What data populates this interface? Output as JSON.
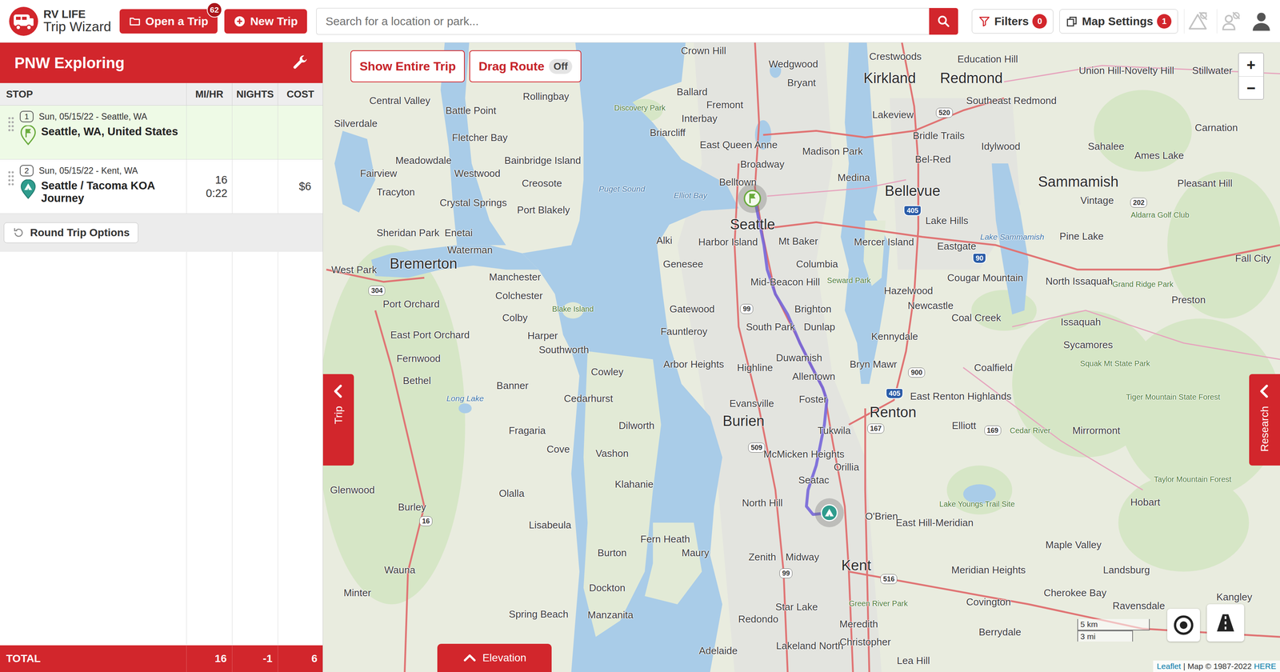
{
  "brand": {
    "line1": "RV LIFE",
    "line2": "Trip Wizard"
  },
  "toolbar": {
    "open_trip": {
      "label": "Open a Trip",
      "badge": "62"
    },
    "new_trip": {
      "label": "New Trip"
    },
    "search": {
      "placeholder": "Search for a location or park..."
    },
    "filters": {
      "label": "Filters",
      "badge": "0"
    },
    "map_settings": {
      "label": "Map Settings",
      "badge": "1"
    },
    "toggles": [
      {
        "kind": "hazard",
        "on": false
      },
      {
        "kind": "person",
        "on": false
      }
    ]
  },
  "trip": {
    "title": "PNW Exploring",
    "columns": [
      "STOP",
      "MI/HR",
      "NIGHTS",
      "COST"
    ],
    "stops": [
      {
        "number": "1",
        "date": "Sun, 05/15/22 - Seattle, WA",
        "name": "Seattle, WA, United States",
        "kind": "start",
        "miles": "",
        "time": "",
        "nights": "",
        "cost": "",
        "selected": true
      },
      {
        "number": "2",
        "date": "Sun, 05/15/22 - Kent, WA",
        "name": "Seattle / Tacoma KOA Journey",
        "kind": "campground",
        "miles": "16",
        "time": "0:22",
        "nights": "",
        "cost": "$6",
        "selected": false
      }
    ],
    "round_trip": "Round Trip Options",
    "total": {
      "label": "TOTAL",
      "miles": "16",
      "nights": "-1",
      "cost": "6"
    }
  },
  "map": {
    "show_entire_trip": "Show Entire Trip",
    "drag_route": {
      "label": "Drag Route",
      "state": "Off",
      "on": false
    },
    "zoom": [
      "+",
      "−"
    ],
    "side_tabs": {
      "trip": "Trip",
      "research": "Research"
    },
    "elevation": "Elevation",
    "scale": {
      "metric": "5 km",
      "imperial": "3 mi"
    },
    "attribution": {
      "leaflet": "Leaflet",
      "copyright": "| Map © 1987-2022",
      "provider": "HERE"
    },
    "cities": [
      "Seattle",
      "Bellevue",
      "Kirkland",
      "Redmond",
      "Renton",
      "Kent",
      "Burien",
      "Bremerton",
      "Sammamish"
    ],
    "places": [
      "Crown Hill",
      "Wedgwood",
      "Bryant",
      "Ballard",
      "Fremont",
      "Interbay",
      "Briarcliff",
      "East Queen Anne",
      "Madison Park",
      "Belltown",
      "Broadway",
      "Medina",
      "Alki",
      "Harbor Island",
      "Mt Baker",
      "Genesee",
      "Columbia",
      "Mid-Beacon Hill",
      "Gatewood",
      "Brighton",
      "Fauntleroy",
      "South Park",
      "Dunlap",
      "Arbor Heights",
      "Highline",
      "Duwamish",
      "Allentown",
      "Bryn Mawr",
      "Evansville",
      "Foster",
      "Tukwila",
      "McMicken Heights",
      "Orillia",
      "Seatac",
      "North Hill",
      "O'Brien",
      "Zenith",
      "Midway",
      "Star Lake",
      "Redondo",
      "Lakeland North",
      "Meredith",
      "Kennydale",
      "Mercer Island",
      "Newcastle",
      "Coal Creek",
      "Coalfield",
      "East Renton Highlands",
      "Elliott",
      "East Hill-Meridian",
      "Lakeview",
      "Bridle Trails",
      "Bel-Red",
      "Lake Hills",
      "Eastgate",
      "Cougar Mountain",
      "Hazelwood",
      "Southeast Redmond",
      "Idylwood",
      "Education Hill",
      "Crestwoods",
      "Union Hill-Novelty Hill",
      "Stillwater",
      "Carnation",
      "Sahalee",
      "Ames Lake",
      "Pleasant Hill",
      "Vintage",
      "Pine Lake",
      "Fall City",
      "North Issaquah",
      "Issaquah",
      "Preston",
      "Sycamores",
      "Mirrormont",
      "Maple Valley",
      "Hobart",
      "Covington",
      "Meridian Heights",
      "Landsburg",
      "Ravensdale",
      "Kangley",
      "Silverdale",
      "Central Valley",
      "Battle Point",
      "Rollingbay",
      "Fletcher Bay",
      "Bainbridge Island",
      "Meadowdale",
      "Westwood",
      "Creosote",
      "Fairview",
      "Tracyton",
      "Crystal Springs",
      "Port Blakely",
      "Sheridan Park",
      "Enetai",
      "Waterman",
      "West Park",
      "Manchester",
      "Port Orchard",
      "Colchester",
      "Colby",
      "East Port Orchard",
      "Harper",
      "Southworth",
      "Fernwood",
      "Cowley",
      "Bethel",
      "Banner",
      "Cedarhurst",
      "Fragaria",
      "Dilworth",
      "Vashon",
      "Cove",
      "Glenwood",
      "Olalla",
      "Klahanie",
      "Burley",
      "Lisabeula",
      "Wauna",
      "Burton",
      "Fern Heath",
      "Maury",
      "Minter",
      "Dockton",
      "Manzanita",
      "Spring Beach",
      "Adelaide",
      "Christopher",
      "Lea Hill",
      "Cherokee Bay",
      "Berrydale"
    ],
    "waters": [
      "Puget Sound",
      "Elliot Bay",
      "Lake Sammamish",
      "Long Lake"
    ],
    "parks": [
      "Discovery Park",
      "Seward Park",
      "Blake Island",
      "Grand Ridge Park",
      "Aldarra Golf Club",
      "Squak Mt State Park",
      "Tiger Mountain State Forest",
      "Taylor Mountain Forest",
      "Lake Youngs Trail Site",
      "Cedar River",
      "Green River Park"
    ],
    "shields": [
      {
        "text": "520",
        "kind": "state"
      },
      {
        "text": "405",
        "kind": "interstate"
      },
      {
        "text": "90",
        "kind": "interstate"
      },
      {
        "text": "99",
        "kind": "state"
      },
      {
        "text": "509",
        "kind": "state"
      },
      {
        "text": "167",
        "kind": "state"
      },
      {
        "text": "169",
        "kind": "state"
      },
      {
        "text": "900",
        "kind": "state"
      },
      {
        "text": "405",
        "kind": "interstate"
      },
      {
        "text": "516",
        "kind": "state"
      },
      {
        "text": "202",
        "kind": "state"
      },
      {
        "text": "16",
        "kind": "state"
      },
      {
        "text": "304",
        "kind": "state"
      },
      {
        "text": "99",
        "kind": "state"
      }
    ]
  }
}
